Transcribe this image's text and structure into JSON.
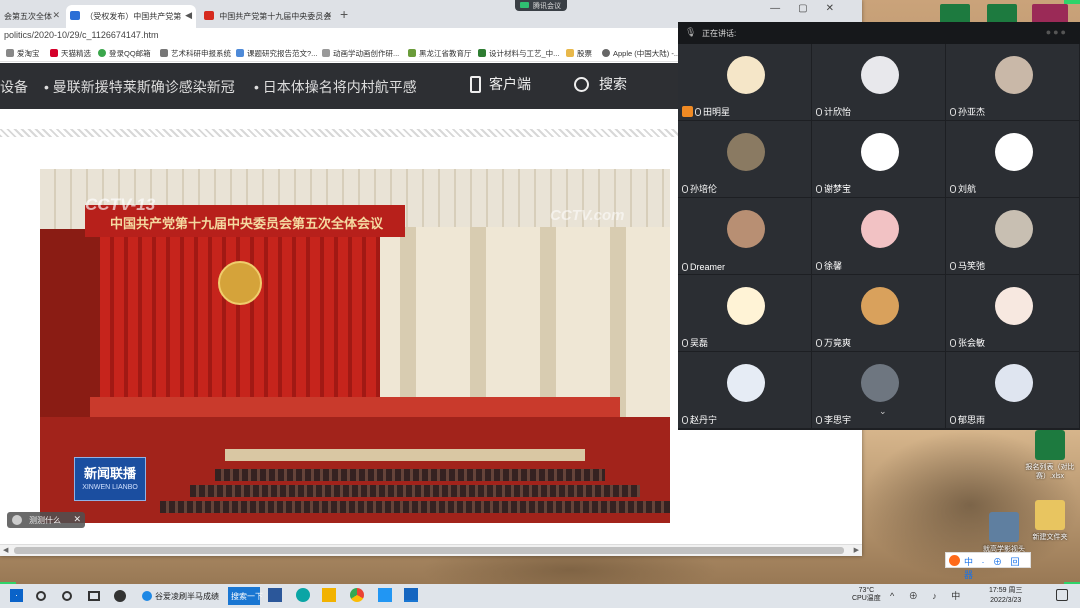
{
  "browser": {
    "tabs": [
      {
        "label": "会第五次全体",
        "active": false
      },
      {
        "label": "（受权发布）中国共产党第",
        "active": true
      },
      {
        "label": "中国共产党第十九届中央委员会",
        "active": false
      }
    ],
    "new_tab": "+",
    "url": "politics/2020-10/29/c_1126674147.htm",
    "bookmarks": [
      "爱淘宝",
      "天猫精选",
      "登录QQ邮箱",
      "艺术科研申报系统",
      "课题研究报告范文?...",
      "动画学动画创作研...",
      "黑龙江省教育厅",
      "设计材料与工艺_中...",
      "股票",
      "Apple (中国大陆) -..."
    ]
  },
  "news_page": {
    "nav_items": [
      "设备",
      "• 曼联新援特莱斯确诊感染新冠",
      "• 日本体操名将内村航平感"
    ],
    "client_label": "客户端",
    "search_label": "搜索",
    "video": {
      "banner_text": "中国共产党第十九届中央委员会第五次全体会议",
      "logo_left": "CCTV-13",
      "logo_right": "CCTV.com",
      "program_zh": "新闻联播",
      "program_en": "XINWEN LIANBO"
    },
    "float_tip": "测测什么"
  },
  "meeting_pill": "腾讯会议",
  "meeting": {
    "speaking_label": "正在讲话:",
    "participants": [
      {
        "name": "田明星",
        "host": true,
        "color": "#f5e6c8"
      },
      {
        "name": "计欣怡",
        "host": false,
        "color": "#e8e8ec"
      },
      {
        "name": "孙亚杰",
        "host": false,
        "color": "#c9b8a8"
      },
      {
        "name": "孙培伦",
        "host": false,
        "color": "#8a7a62"
      },
      {
        "name": "谢梦宝",
        "host": false,
        "color": "#ffffff"
      },
      {
        "name": "刘航",
        "host": false,
        "color": "#ffffff"
      },
      {
        "name": "Dreamer",
        "host": false,
        "color": "#b88f73"
      },
      {
        "name": "徐馨",
        "host": false,
        "color": "#f2c2c4"
      },
      {
        "name": "马笑弛",
        "host": false,
        "color": "#c8bfb2"
      },
      {
        "name": "吴磊",
        "host": false,
        "color": "#fff3d6"
      },
      {
        "name": "万竟爽",
        "host": false,
        "color": "#d9a15c"
      },
      {
        "name": "张会敏",
        "host": false,
        "color": "#f7e8e0"
      },
      {
        "name": "赵丹宁",
        "host": false,
        "color": "#e6ecf5"
      },
      {
        "name": "李思宇",
        "host": false,
        "color": "#6e7680"
      },
      {
        "name": "郁思雨",
        "host": false,
        "color": "#dfe5f0"
      }
    ]
  },
  "desktop": {
    "icons": [
      {
        "label": "报名列表（对比赛）.xlsx",
        "color": "#1d7a3f"
      },
      {
        "label": "就高学影视头",
        "color": "#5f7fa0"
      },
      {
        "label": "新建文件夹",
        "color": "#e8c560"
      }
    ],
    "ime": "中 · ⊕ 回 器"
  },
  "taskbar": {
    "browser_task": "谷爱凌刷半马成绩",
    "search_btn": "搜索一下",
    "weather_temp": "73°C",
    "weather_label": "CPU温度",
    "tray": "^ ⊕ ♪ 中",
    "time": "17:59 周三",
    "date": "2022/3/23"
  }
}
